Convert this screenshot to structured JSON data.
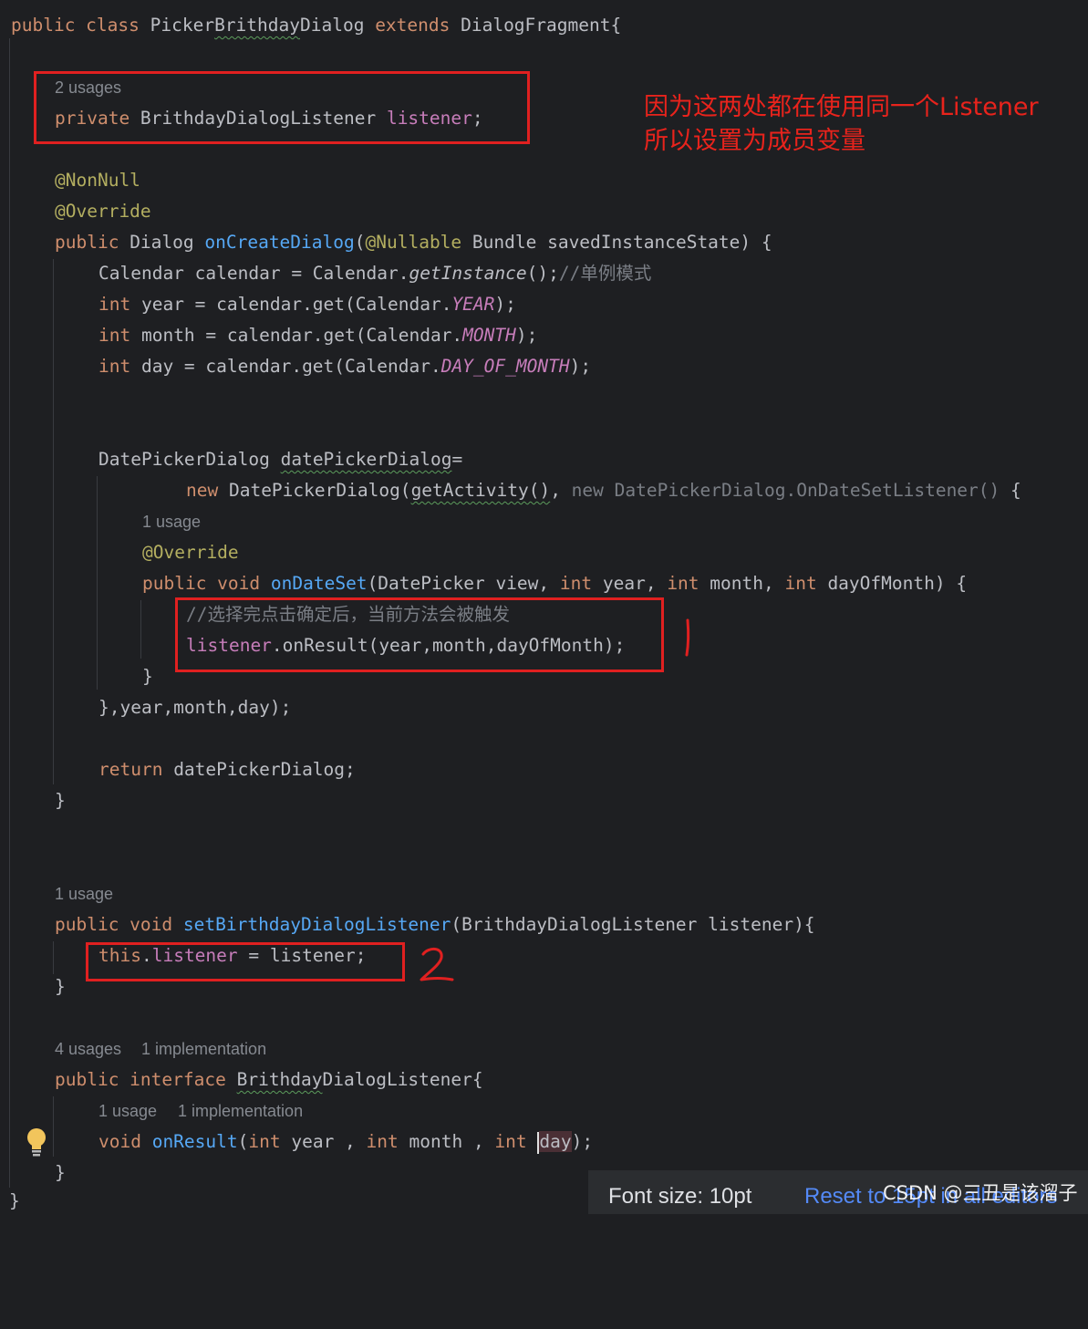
{
  "editor": {
    "hints": {
      "usages_listener": "2 usages",
      "usage_ondateset": "1 usage",
      "usage_setter": "1 usage",
      "usages_interface": "4 usages",
      "impl_interface": "1 implementation",
      "usage_onresult": "1 usage",
      "impl_onresult": "1 implementation"
    },
    "comments": {
      "singleton": "//单例模式",
      "triggered": "//选择完点击确定后，当前方法会被触发"
    }
  },
  "annotation": {
    "note_line1": "因为这两处都在使用同一个Listener",
    "note_line2": "所以设置为成员变量",
    "mark_1": "1",
    "mark_2": "2"
  },
  "statusbar": {
    "font_size": "Font size: 10pt",
    "reset": "Reset to 15pt in all editors"
  },
  "watermark": "CSDN @三丑是该溜子",
  "colors": {
    "background": "#1e1f22",
    "keyword": "#cf8e6d",
    "function": "#56a8f5",
    "annotation": "#b3ae60",
    "field": "#c77dba",
    "annotation_red": "#e02020"
  }
}
